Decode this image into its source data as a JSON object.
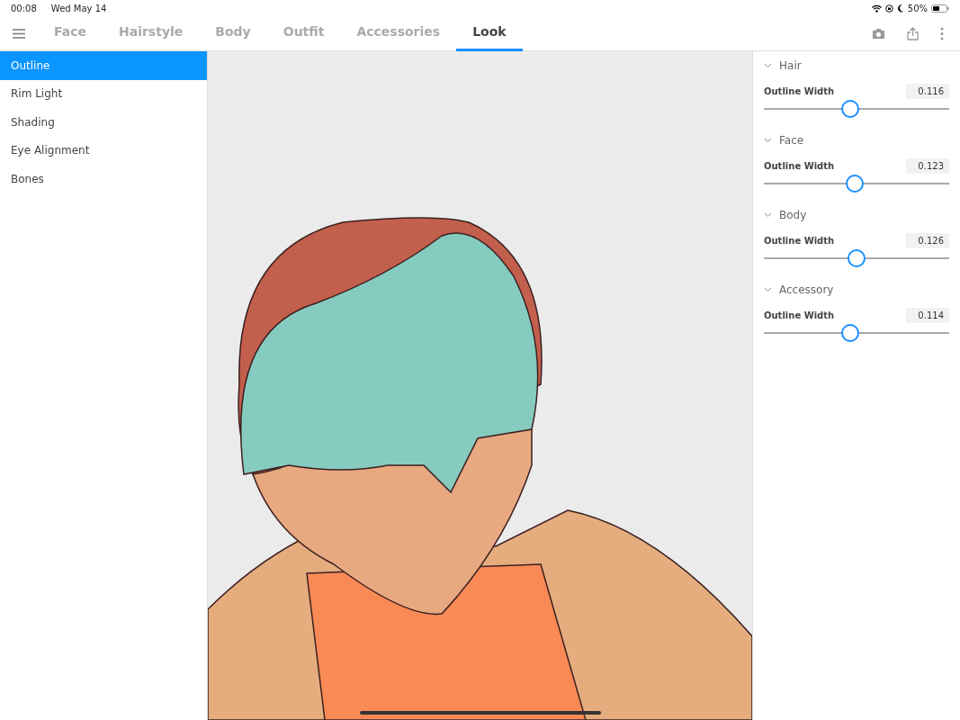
{
  "status_bar": {
    "time": "00:08",
    "date": "Wed May 14",
    "battery": "50%"
  },
  "tabs": [
    {
      "label": "Face",
      "selected": false
    },
    {
      "label": "Hairstyle",
      "selected": false
    },
    {
      "label": "Body",
      "selected": false
    },
    {
      "label": "Outfit",
      "selected": false
    },
    {
      "label": "Accessories",
      "selected": false
    },
    {
      "label": "Look",
      "selected": true
    }
  ],
  "sidebar": {
    "items": [
      {
        "label": "Outline",
        "selected": true
      },
      {
        "label": "Rim Light",
        "selected": false
      },
      {
        "label": "Shading",
        "selected": false
      },
      {
        "label": "Eye Alignment",
        "selected": false
      },
      {
        "label": "Bones",
        "selected": false
      }
    ]
  },
  "panel": {
    "sections": [
      {
        "title": "Hair",
        "expanded": true,
        "setting": "Outline Width",
        "value": "0.116",
        "level": 0.46
      },
      {
        "title": "Face",
        "expanded": true,
        "setting": "Outline Width",
        "value": "0.123",
        "level": 0.49
      },
      {
        "title": "Body",
        "expanded": true,
        "setting": "Outline Width",
        "value": "0.126",
        "level": 0.5
      },
      {
        "title": "Accessory",
        "expanded": true,
        "setting": "Outline Width",
        "value": "0.114",
        "level": 0.46
      }
    ]
  }
}
